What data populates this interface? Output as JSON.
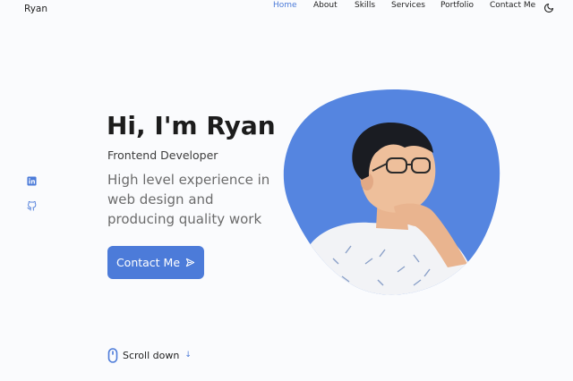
{
  "header": {
    "logo": "Ryan",
    "nav": [
      {
        "label": "Home",
        "active": true
      },
      {
        "label": "About",
        "active": false
      },
      {
        "label": "Skills",
        "active": false
      },
      {
        "label": "Services",
        "active": false
      },
      {
        "label": "Portfolio",
        "active": false
      },
      {
        "label": "Contact Me",
        "active": false
      }
    ],
    "theme_icon": "moon-icon"
  },
  "social": [
    "linkedin-icon",
    "github-icon"
  ],
  "hero": {
    "title": "Hi, I'm Ryan",
    "subtitle": "Frontend Developer",
    "description": "High level experience in web design and producing quality work",
    "button_label": "Contact Me",
    "button_icon": "send-icon"
  },
  "scroll": {
    "label": "Scroll down",
    "icon": "mouse-icon",
    "arrow": "↓"
  },
  "colors": {
    "accent": "#4c7bd9",
    "background": "#fafbfd",
    "text": "#1f1f1f"
  }
}
